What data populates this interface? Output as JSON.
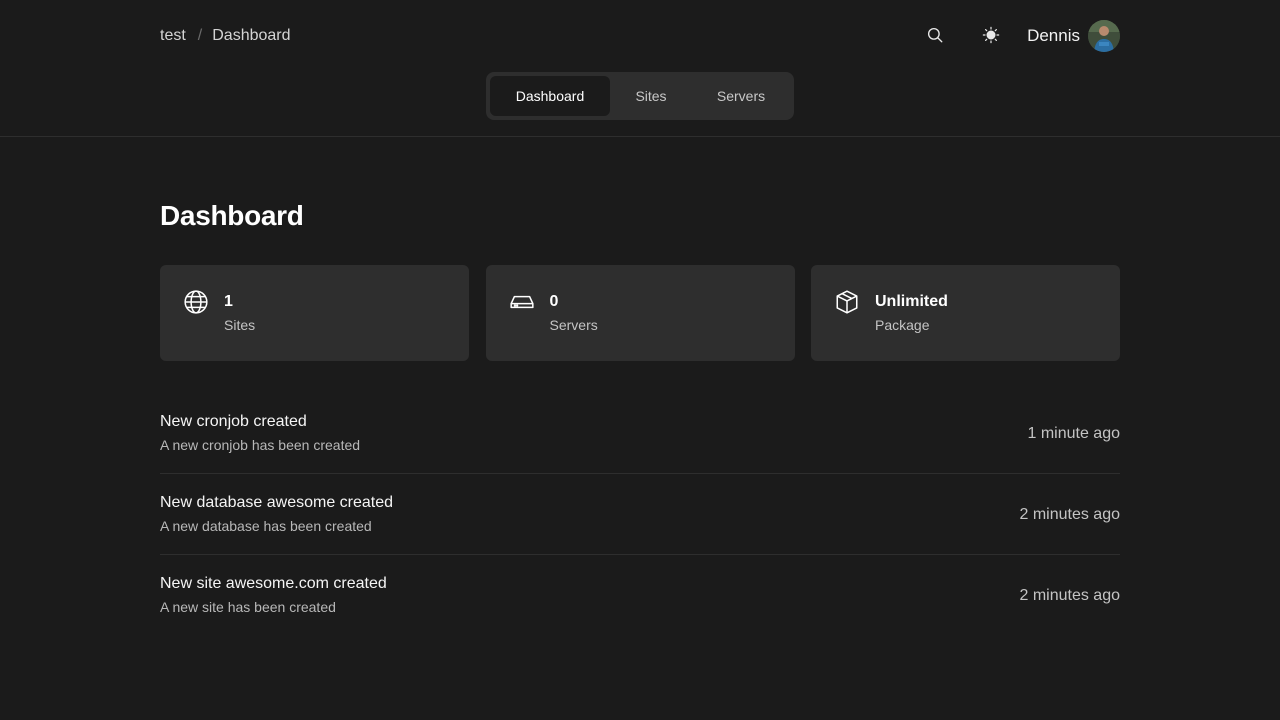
{
  "breadcrumb": {
    "project": "test",
    "separator": "/",
    "current": "Dashboard"
  },
  "header": {
    "search_icon": "search-icon",
    "theme_icon": "sun-icon",
    "user_name": "Dennis"
  },
  "tabs": [
    {
      "label": "Dashboard",
      "active": true
    },
    {
      "label": "Sites",
      "active": false
    },
    {
      "label": "Servers",
      "active": false
    }
  ],
  "page": {
    "title": "Dashboard"
  },
  "stats": [
    {
      "icon": "globe-icon",
      "value": "1",
      "label": "Sites"
    },
    {
      "icon": "server-drive-icon",
      "value": "0",
      "label": "Servers"
    },
    {
      "icon": "package-cube-icon",
      "value": "Unlimited",
      "label": "Package"
    }
  ],
  "activity": [
    {
      "title": "New cronjob created",
      "description": "A new cronjob has been created",
      "time": "1 minute ago"
    },
    {
      "title": "New database awesome created",
      "description": "A new database has been created",
      "time": "2 minutes ago"
    },
    {
      "title": "New site awesome.com created",
      "description": "A new site has been created",
      "time": "2 minutes ago"
    }
  ],
  "colors": {
    "background": "#1b1b1b",
    "card": "#2e2e2e",
    "text": "#ffffff",
    "muted": "#c4c4c4"
  }
}
